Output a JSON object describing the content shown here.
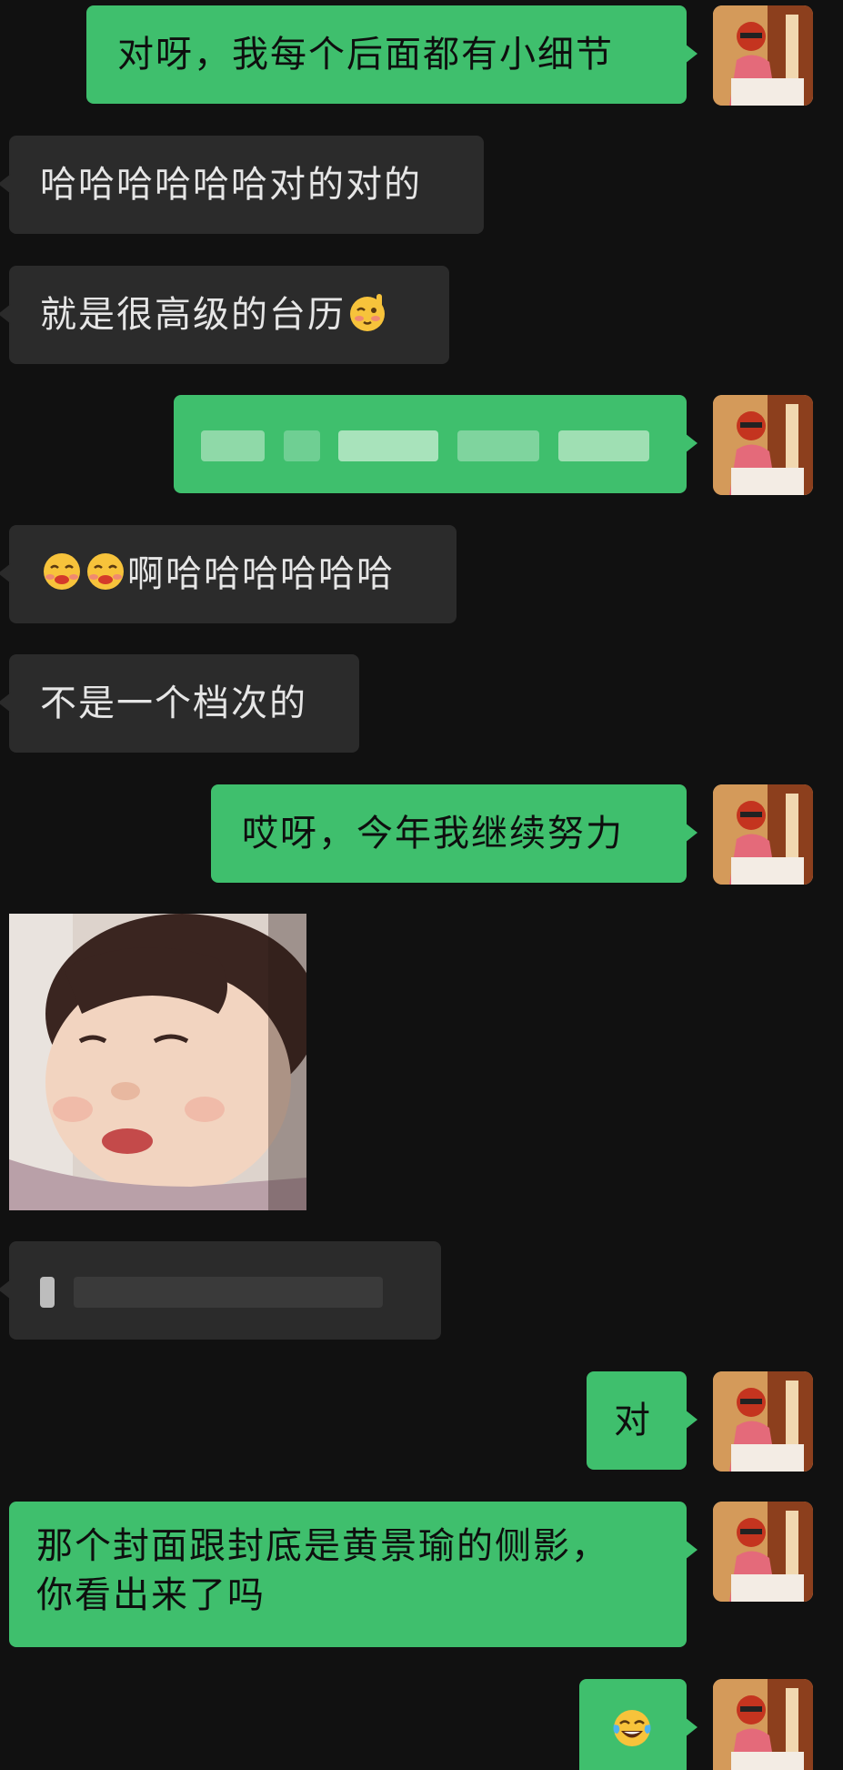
{
  "messages": [
    {
      "side": "out",
      "text": "对呀，我每个后面都有小细节"
    },
    {
      "side": "in",
      "text": "哈哈哈哈哈哈对的对的"
    },
    {
      "side": "in",
      "text": "就是很高级的台历",
      "emoji": "blushing-wink-emoji"
    },
    {
      "side": "out",
      "text": "",
      "blurred": true
    },
    {
      "side": "in",
      "text": "啊哈哈哈哈哈哈",
      "emoji": "shy-smile-emoji"
    },
    {
      "side": "in",
      "text": "不是一个档次的"
    },
    {
      "side": "out",
      "text": "哎呀，今年我继续努力"
    },
    {
      "side": "in",
      "image": "baby-photo"
    },
    {
      "side": "in",
      "text": "",
      "blurred": true
    },
    {
      "side": "out",
      "text": "对"
    },
    {
      "side": "out",
      "text_line1": "那个封面跟封底是黄景瑜的侧影，",
      "text_line2": "你看出来了吗"
    },
    {
      "side": "out",
      "text": "",
      "emoji": "tears-of-joy-emoji"
    }
  ],
  "colors": {
    "background": "#111111",
    "outgoing_bubble": "#3fbf6d",
    "incoming_bubble": "#2b2b2b",
    "incoming_text": "#e6e6e6"
  }
}
